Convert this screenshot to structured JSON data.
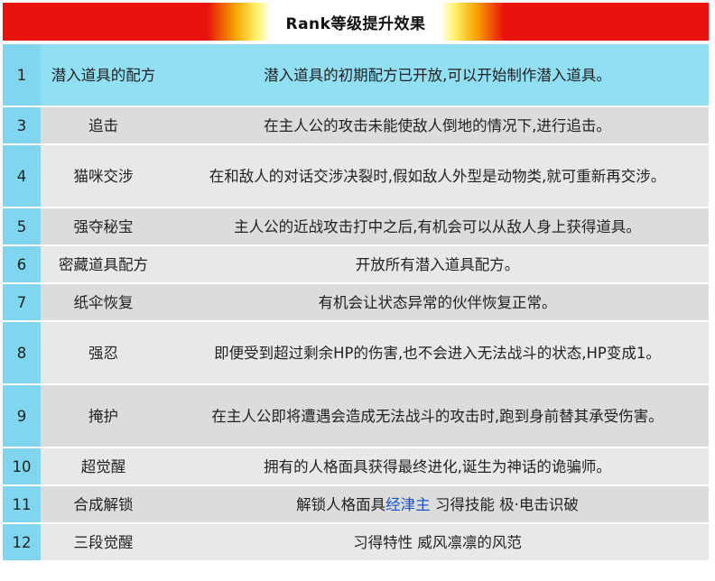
{
  "title": "Rank等级提升效果",
  "colors": {
    "header_red": "#e8130c",
    "num_cell": "#7fd6ee",
    "first_row": "#90dff2",
    "row_light": "#e8e8e8",
    "row_dark": "#dcdcdc",
    "link": "#1a55c7"
  },
  "rows": [
    {
      "rank": "1",
      "name": "潜入道具的配方",
      "effect": "潜入道具的初期配方已开放,可以开始制作潜入道具。"
    },
    {
      "rank": "3",
      "name": "追击",
      "effect": "在主人公的攻击未能使敌人倒地的情况下,进行追击。"
    },
    {
      "rank": "4",
      "name": "猫咪交涉",
      "effect": "在和敌人的对话交涉决裂时,假如敌人外型是动物类,就可重新再交涉。"
    },
    {
      "rank": "5",
      "name": "强夺秘宝",
      "effect": "主人公的近战攻击打中之后,有机会可以从敌人身上获得道具。"
    },
    {
      "rank": "6",
      "name": "密藏道具配方",
      "effect": "开放所有潜入道具配方。"
    },
    {
      "rank": "7",
      "name": "纸伞恢复",
      "effect": "有机会让状态异常的伙伴恢复正常。"
    },
    {
      "rank": "8",
      "name": "强忍",
      "effect": "即便受到超过剩余HP的伤害,也不会进入无法战斗的状态,HP变成1。"
    },
    {
      "rank": "9",
      "name": "掩护",
      "effect": "在主人公即将遭遇会造成无法战斗的攻击时,跑到身前替其承受伤害。"
    },
    {
      "rank": "10",
      "name": "超觉醒",
      "effect": "拥有的人格面具获得最终进化,诞生为神话的诡骗师。"
    },
    {
      "rank": "11",
      "name": "合成解锁",
      "effect_pre": "解锁人格面具",
      "effect_link": "经津主",
      "effect_post": " 习得技能 极·电击识破"
    },
    {
      "rank": "12",
      "name": "三段觉醒",
      "effect": "习得特性 威风凛凛的风范"
    }
  ]
}
